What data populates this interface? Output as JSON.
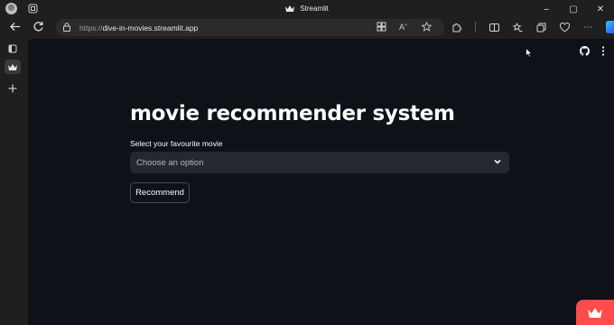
{
  "window": {
    "title": "Streamlit",
    "minimize": "–",
    "maximize": "▢",
    "close": "✕"
  },
  "browser": {
    "url_prefix": "https://",
    "url_host": "dive-in-movies.streamlit.app"
  },
  "app": {
    "title": "movie recommender system",
    "select_label": "Select your favourite movie",
    "select_placeholder": "Choose an option",
    "button_label": "Recommend"
  },
  "colors": {
    "app_bg": "#0e1117",
    "select_bg": "#262730",
    "accent": "#ff4b4b"
  }
}
